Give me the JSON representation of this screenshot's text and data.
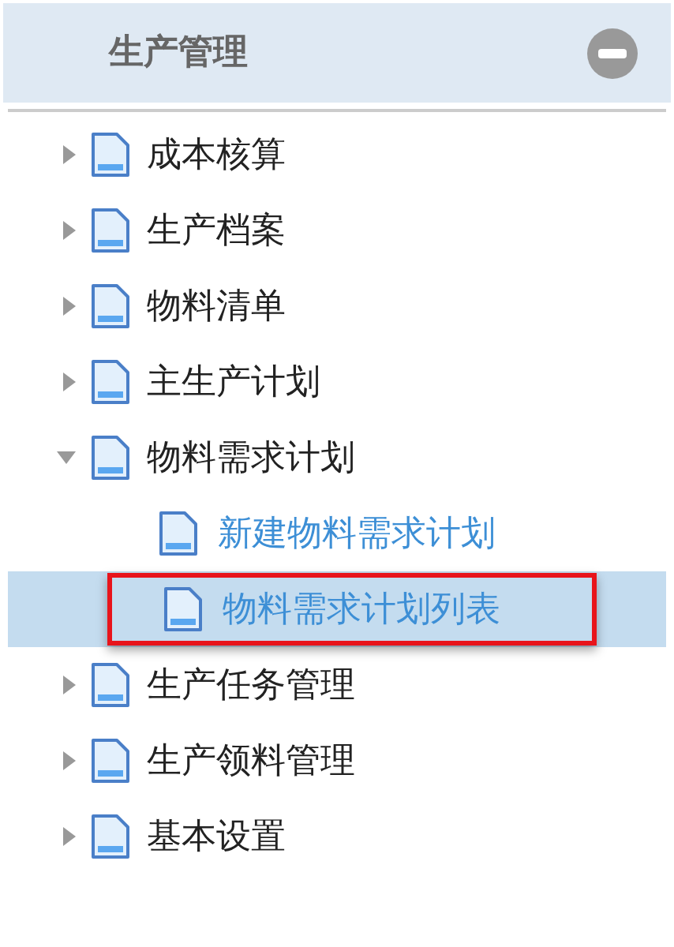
{
  "panel": {
    "title": "生产管理",
    "expanded": true
  },
  "tree": [
    {
      "label": "成本核算",
      "expanded": false,
      "selected": false
    },
    {
      "label": "生产档案",
      "expanded": false,
      "selected": false
    },
    {
      "label": "物料清单",
      "expanded": false,
      "selected": false
    },
    {
      "label": "主生产计划",
      "expanded": false,
      "selected": false
    },
    {
      "label": "物料需求计划",
      "expanded": true,
      "selected": false,
      "children": [
        {
          "label": "新建物料需求计划",
          "selected": false
        },
        {
          "label": "物料需求计划列表",
          "selected": true
        }
      ]
    },
    {
      "label": "生产任务管理",
      "expanded": false,
      "selected": false
    },
    {
      "label": "生产领料管理",
      "expanded": false,
      "selected": false
    },
    {
      "label": "基本设置",
      "expanded": false,
      "selected": false
    }
  ]
}
